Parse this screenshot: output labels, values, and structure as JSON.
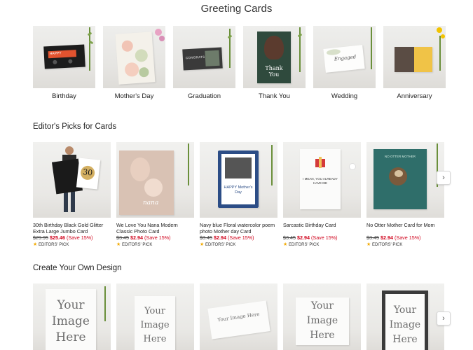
{
  "page_title": "Greeting Cards",
  "categories": [
    {
      "label": "Birthday"
    },
    {
      "label": "Mother's Day"
    },
    {
      "label": "Graduation"
    },
    {
      "label": "Thank You"
    },
    {
      "label": "Wedding"
    },
    {
      "label": "Anniversary"
    }
  ],
  "editors_picks": {
    "title": "Editor's Picks for Cards",
    "items": [
      {
        "name": "30th Birthday Black Gold Glitter Extra Large Jumbo Card",
        "old_price": "$29.95",
        "new_price": "$25.46",
        "save": "(Save 15%)",
        "badge": "EDITORS' PICK",
        "art_text": "30"
      },
      {
        "name": "We Love You Nana Modern Classic Photo Card",
        "old_price": "$3.45",
        "new_price": "$2.94",
        "save": "(Save 15%)",
        "badge": "EDITORS' PICK",
        "art_text": "nana"
      },
      {
        "name": "Navy blue Floral watercolor poem photo Mother day Card",
        "old_price": "$3.45",
        "new_price": "$2.94",
        "save": "(Save 15%)",
        "badge": "EDITORS' PICK",
        "art_text": "HAPPY Mother's Day"
      },
      {
        "name": "Sarcastic Birthday Card",
        "old_price": "$3.45",
        "new_price": "$2.94",
        "save": "(Save 15%)",
        "badge": "EDITORS' PICK",
        "art_text": "I MEAN, YOU ALREADY HAVE ME"
      },
      {
        "name": "No Otter Mother Card for Mom",
        "old_price": "$3.45",
        "new_price": "$2.94",
        "save": "(Save 15%)",
        "badge": "EDITORS' PICK",
        "art_text": "NO OTTER MOTHER"
      }
    ]
  },
  "create_own": {
    "title": "Create Your Own Design",
    "placeholder_text": "Your Image Here"
  },
  "card_art": {
    "birthday_text": "HAPPY",
    "graduation_text": "CONGRATS",
    "thank_you_text": "Thank You",
    "wedding_text": "Engaged"
  },
  "colors": {
    "sale_red": "#d0021b",
    "star_gold": "#f2a900",
    "stem_green": "#6a8f3a"
  },
  "icons": {
    "next_arrow": "chevron-right-icon",
    "badge_star": "star-icon"
  }
}
